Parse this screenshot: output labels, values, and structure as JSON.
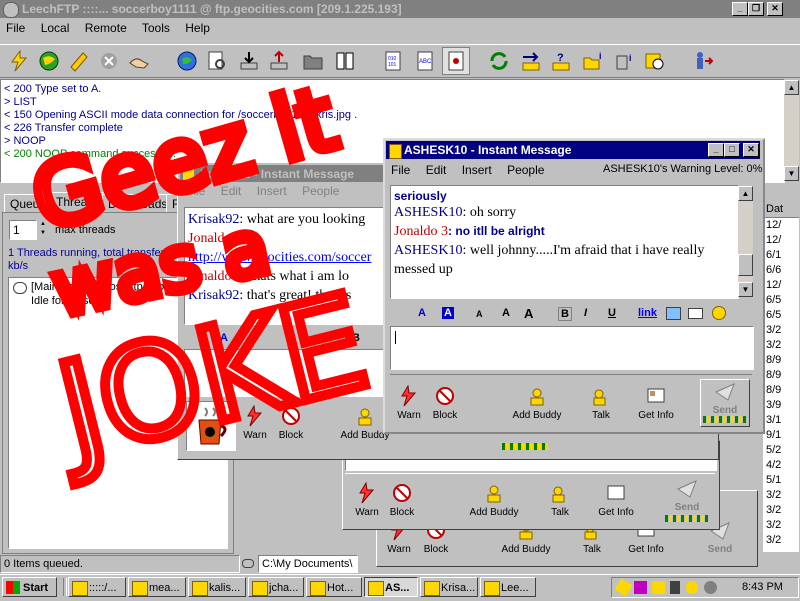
{
  "leech": {
    "title": "LeechFTP ::::...  soccerboy1111 @ ftp.geocities.com [209.1.225.193]",
    "menu": [
      "File",
      "Local",
      "Remote",
      "Tools",
      "Help"
    ],
    "log": [
      {
        "text": "< 200 Type set to A.",
        "color": "#00008b"
      },
      {
        "text": "> LIST",
        "color": "#00008b"
      },
      {
        "text": "< 150 Opening ASCII mode data connection for /soccerboy1111/kris.jpg .",
        "color": "#00008b"
      },
      {
        "text": "< 226 Transfer complete",
        "color": "#00008b"
      },
      {
        "text": "> NOOP",
        "color": "#00008b"
      },
      {
        "text": "< 200 NOOP command successful.",
        "color": "#008000"
      }
    ],
    "tabs": [
      "Queue",
      "Threads",
      "Downloads",
      "F"
    ],
    "threads_value": "1",
    "max_threads_label": "max threads",
    "threads_info": "1 Threads running, total transfer speed: 0 kb/s",
    "thread_entry": "[Main Thread] Host: ftp.geocities.com",
    "thread_idle": "Idle for 94 sec",
    "status": "0 Items queued.",
    "local_path": "C:\\My Documents\\",
    "right_dates": [
      "Dat",
      "12/",
      "12/",
      "6/1",
      "6/6",
      "12/",
      "6/5",
      "6/5",
      "3/2",
      "3/2",
      "8/9",
      "8/9",
      "8/9",
      "3/9",
      "3/1",
      "9/1",
      "5/2",
      "4/2",
      "5/1",
      "3/2",
      "3/2",
      "3/2",
      "3/2"
    ]
  },
  "im_back": {
    "title": "Krisak92 - Instant Message",
    "menu": [
      "File",
      "Edit",
      "Insert",
      "People"
    ],
    "lines": [
      {
        "sn": "Krisak92",
        "msg": ": what are you looking",
        "cls": "sn-blue"
      },
      {
        "sn": "Jonaldo 3",
        "msg": ":",
        "cls": "sn-red"
      },
      {
        "sn": "",
        "msg": "http://www.geocities.com/soccer",
        "cls": "link"
      },
      {
        "sn": "Jonaldo 3",
        "msg": ": thats what i am lo",
        "cls": "sn-red"
      },
      {
        "sn": "Krisak92",
        "msg": ": that's great! there's",
        "cls": "sn-blue"
      }
    ],
    "buttons": [
      "Warn",
      "Block",
      "Add Buddy",
      "Talk",
      "Get Info"
    ]
  },
  "im_front": {
    "title": "ASHESK10 - Instant Message",
    "menu": [
      "File",
      "Edit",
      "Insert",
      "People"
    ],
    "warning": "ASHESK10's Warning Level: 0%",
    "lines": [
      {
        "sn": "",
        "msg": "seriously",
        "cls": "plain-blue"
      },
      {
        "sn": "ASHESK10",
        "msg": ": oh sorry",
        "cls": "sn-blue"
      },
      {
        "sn": "Jonaldo 3",
        "msg": ": no itll be alright",
        "cls": "sn-red"
      },
      {
        "sn": "ASHESK10",
        "msg": ": well johnny.....I'm afraid that i have really messed up",
        "cls": "sn-blue"
      }
    ],
    "format_buttons": [
      "A",
      "A",
      "A",
      "A",
      "A",
      "B",
      "I",
      "U",
      "link"
    ],
    "buttons": [
      "Warn",
      "Block",
      "Add Buddy",
      "Talk",
      "Get Info",
      "Send"
    ]
  },
  "im_lower1": {
    "buttons": [
      "Warn",
      "Block",
      "Add Buddy",
      "Talk",
      "Get Info",
      "Send"
    ]
  },
  "im_lower2": {
    "buttons": [
      "Warn",
      "Block",
      "Add Buddy",
      "Talk",
      "Get Info",
      "Send"
    ]
  },
  "scribble": {
    "lines": [
      "Geez it",
      "was a",
      "JOKE"
    ],
    "color": "#ff0000"
  },
  "taskbar": {
    "start": "Start",
    "items": [
      ":::::/...",
      "mea...",
      "kalis...",
      "jcha...",
      "Hot...",
      "AS...",
      "Krisa...",
      "Lee..."
    ],
    "active_index": 5,
    "clock": "8:43 PM"
  }
}
